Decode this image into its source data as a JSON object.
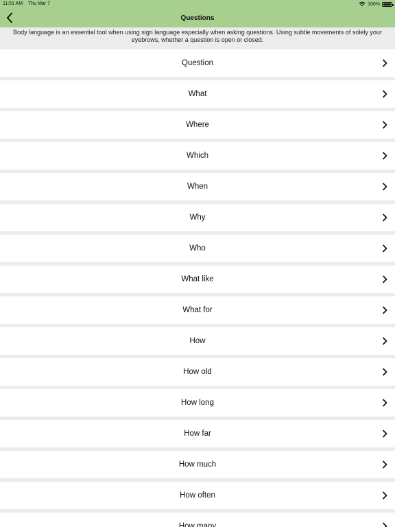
{
  "status": {
    "time": "11:51 AM",
    "date": "Thu Mar 7",
    "battery": "100%"
  },
  "nav": {
    "title": "Questions",
    "back_icon": "chevron-left-icon"
  },
  "intro_text": "Body language is an essential tool when using sign language especially when asking questions. Using subtle movements of solely your eyebrows, whether a question is open or closed.",
  "colors": {
    "header": "#a7d08f",
    "background": "#ececec",
    "row": "#ffffff"
  },
  "items": [
    {
      "label": "Question"
    },
    {
      "label": "What"
    },
    {
      "label": "Where"
    },
    {
      "label": "Which"
    },
    {
      "label": "When"
    },
    {
      "label": "Why"
    },
    {
      "label": "Who"
    },
    {
      "label": "What like"
    },
    {
      "label": "What for"
    },
    {
      "label": "How"
    },
    {
      "label": "How old"
    },
    {
      "label": "How long"
    },
    {
      "label": "How far"
    },
    {
      "label": "How much"
    },
    {
      "label": "How often"
    },
    {
      "label": "How many"
    }
  ]
}
